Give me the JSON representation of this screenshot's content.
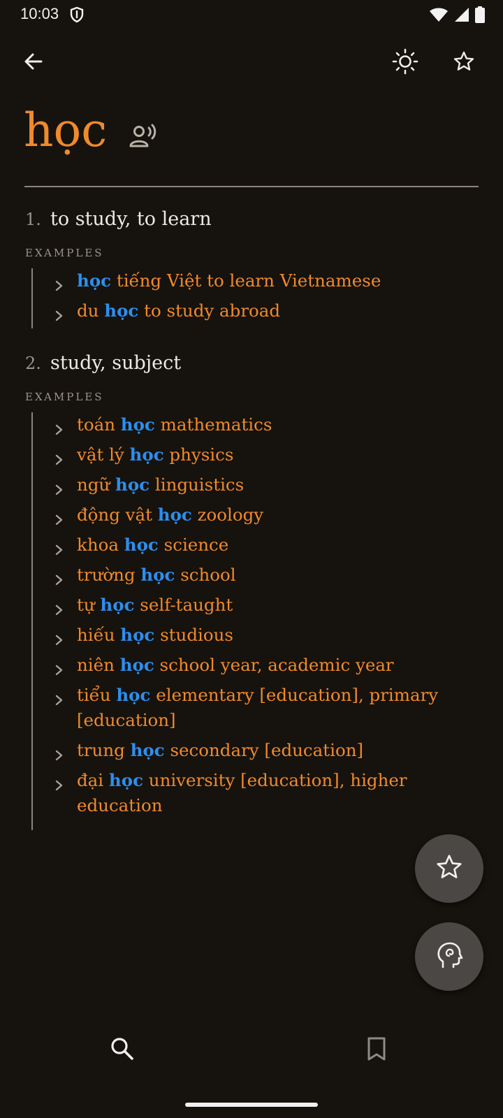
{
  "status": {
    "time": "10:03"
  },
  "entry": {
    "headword": "học",
    "examples_label": "EXAMPLES",
    "senses": [
      {
        "number": "1.",
        "definition": "to study, to learn",
        "examples": [
          {
            "pre": "",
            "word": "học",
            "post": " tiếng Việt to learn Vietnamese"
          },
          {
            "pre": "du ",
            "word": "học",
            "post": " to study abroad"
          }
        ]
      },
      {
        "number": "2.",
        "definition": "study, subject",
        "examples": [
          {
            "pre": "toán ",
            "word": "học",
            "post": " mathematics"
          },
          {
            "pre": "vật lý ",
            "word": "học",
            "post": " physics"
          },
          {
            "pre": "ngữ ",
            "word": "học",
            "post": " linguistics"
          },
          {
            "pre": "động vật ",
            "word": "học",
            "post": " zoology"
          },
          {
            "pre": "khoa ",
            "word": "học",
            "post": " science"
          },
          {
            "pre": "trường ",
            "word": "học",
            "post": " school"
          },
          {
            "pre": "tự ",
            "word": "học",
            "post": " self-taught"
          },
          {
            "pre": "hiếu ",
            "word": "học",
            "post": " studious"
          },
          {
            "pre": "niên ",
            "word": "học",
            "post": " school year, academic year"
          },
          {
            "pre": "tiểu ",
            "word": "học",
            "post": " elementary [education], primary [education]"
          },
          {
            "pre": "trung ",
            "word": "học",
            "post": " secondary [education]"
          },
          {
            "pre": "đại ",
            "word": "học",
            "post": " university [education], higher education"
          }
        ]
      }
    ]
  },
  "icons": {
    "back": "arrow-back-icon",
    "theme": "brightness-icon",
    "favorite": "star-outline-icon",
    "pronounce": "speak-icon",
    "fab_star": "star-outline-icon",
    "fab_study": "psychology-icon",
    "nav_search": "search-icon",
    "nav_bookmarks": "bookmark-icon"
  },
  "colors": {
    "background": "#16120d",
    "headword": "#f08a2c",
    "highlight": "#2b8ff0",
    "example_text": "#f08a2c",
    "fab": "#4a4744"
  }
}
